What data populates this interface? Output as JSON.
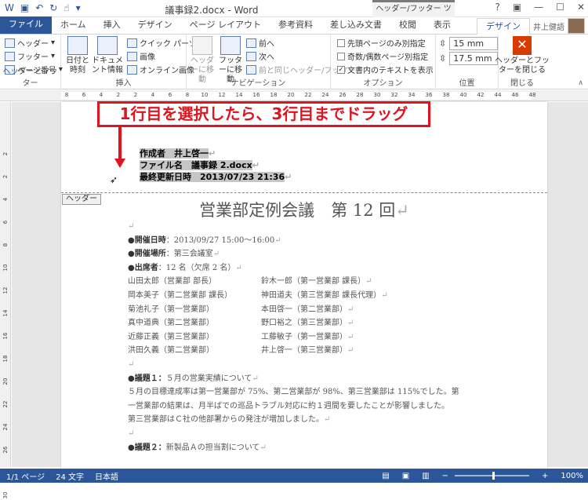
{
  "window": {
    "title": "議事録2.docx - Word",
    "context_tool": "ヘッダー/フッター ツール",
    "help": "?",
    "user": "井上健語"
  },
  "tabs": [
    "ファイル",
    "ホーム",
    "挿入",
    "デザイン",
    "ページ レイアウト",
    "参考資料",
    "差し込み文書",
    "校閲",
    "表示",
    "デザイン"
  ],
  "ribbon": {
    "hf": {
      "header": "ヘッダー",
      "footer": "フッター",
      "page_number": "ページ番号",
      "label": "ヘッダーとフッター"
    },
    "insert": {
      "datetime": "日付と時刻",
      "docinfo": "ドキュメント情報",
      "quickparts": "クイック パーツ",
      "image": "画像",
      "online_image": "オンライン画像",
      "label": "挿入"
    },
    "nav": {
      "goto_header": "ヘッダーに移動",
      "goto_footer": "フッターに移動",
      "prev": "前へ",
      "next": "次へ",
      "link_prev": "前と同じヘッダー/フッター",
      "label": "ナビゲーション"
    },
    "options": {
      "first_page": "先頭ページのみ別指定",
      "odd_even": "奇数/偶数ページ別指定",
      "show_text": "文書内のテキストを表示",
      "label": "オプション"
    },
    "position": {
      "header_pos": "15 mm",
      "footer_pos": "17.5 mm",
      "label": "位置"
    },
    "close": {
      "button": "ヘッダーとフッターを閉じる",
      "label": "閉じる"
    }
  },
  "ruler_h": [
    "8",
    "6",
    "4",
    "2",
    "2",
    "4",
    "6",
    "8",
    "10",
    "12",
    "14",
    "16",
    "18",
    "20",
    "22",
    "24",
    "26",
    "28",
    "30",
    "32",
    "34",
    "36",
    "38",
    "40",
    "42",
    "44",
    "46",
    "48"
  ],
  "ruler_v": [
    "2",
    "2",
    "4",
    "6",
    "8",
    "10",
    "12",
    "14",
    "16",
    "18",
    "20",
    "22",
    "24",
    "26",
    "28",
    "30"
  ],
  "callout": "1行目を選択したら、3行目までドラッグ",
  "header_lines": [
    {
      "label": "作成者　",
      "value": "井上啓一"
    },
    {
      "label": "ファイル名　",
      "value": "議事録 2.docx"
    },
    {
      "label": "最終更新日時　",
      "value": "2013/07/23 21:36"
    }
  ],
  "header_tag": "ヘッダー",
  "doc": {
    "title": "営業部定例会議　第 12 回",
    "datetime_label": "●開催日時",
    "datetime": "：2013/09/27 15:00～16:00",
    "place_label": "●開催場所",
    "place": "：第三会議室",
    "attendees_label": "●出席者",
    "attendees": "：12 名（欠席 2 名）",
    "members": [
      [
        "山田太郎（営業部 部長）",
        "鈴木一郎（第一営業部 課長）"
      ],
      [
        "岡本美子（第二営業部 課長）",
        "神田道夫（第三営業部 課長代理）"
      ],
      [
        "菊池礼子（第一営業部）",
        "本田啓一（第二営業部）"
      ],
      [
        "真中道典（第二営業部）",
        "野口裕之（第三営業部）"
      ],
      [
        "近藤正義（第三営業部）",
        "工藤敏子（第一営業部）"
      ],
      [
        "洪田久義（第二営業部）",
        "井上啓一（第三営業部）"
      ]
    ],
    "agenda1_label": "●議題１：",
    "agenda1": "５月の営業実績について",
    "para": [
      "５月の目標達成率は第一営業部が 75%、第二営業部が 98%、第三営業部は 115%でした。第",
      "一営業部の結果は、月半ばでの巡品トラブル対応に約１週間を要したことが影響しました。",
      "第三営業部はＣ社の他部署からの発注が増加しました。"
    ],
    "agenda2_label": "●議題２：",
    "agenda2": "新製品Ａの担当割について"
  },
  "status": {
    "page": "1/1 ページ",
    "words": "24 文字",
    "lang": "日本語",
    "zoom": "100%"
  },
  "accent": "#2b579a",
  "highlight": "#e0141e"
}
